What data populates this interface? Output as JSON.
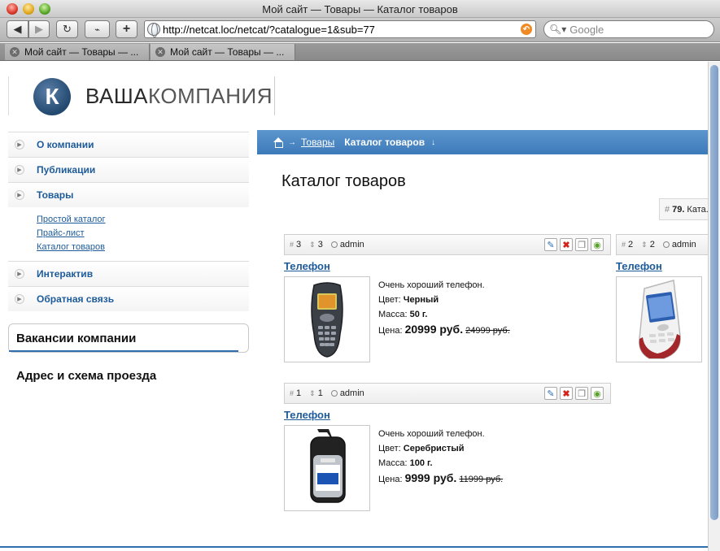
{
  "browser": {
    "window_title": "Мой сайт — Товары — Каталог товаров",
    "url": "http://netcat.loc/netcat/?catalogue=1&sub=77",
    "search_placeholder": "Google",
    "tabs": [
      {
        "label": "Мой сайт — Товары — ..."
      },
      {
        "label": "Мой сайт — Товары — ..."
      }
    ]
  },
  "site": {
    "logo_letter": "К",
    "logo_bold": "ВАША",
    "logo_light": "КОМПАНИЯ"
  },
  "menu": {
    "items": [
      {
        "label": "О компании"
      },
      {
        "label": "Публикации"
      },
      {
        "label": "Товары"
      },
      {
        "label": "Интерактив"
      },
      {
        "label": "Обратная связь"
      }
    ],
    "submenu": [
      {
        "label": "Простой каталог"
      },
      {
        "label": "Прайс-лист"
      },
      {
        "label": "Каталог товаров"
      }
    ],
    "vacancy_title": "Вакансии компании",
    "address_title": "Адрес и схема проезда"
  },
  "breadcrumb": {
    "link": "Товары",
    "current": "Каталог товаров"
  },
  "page": {
    "heading": "Каталог товаров",
    "sort_num": "79.",
    "sort_text": "Ката..."
  },
  "products": [
    {
      "id": "3",
      "priority": "3",
      "user": "admin",
      "title": "Телефон",
      "description": "Очень хороший телефон.",
      "color_label": "Цвет:",
      "color": "Черный",
      "mass_label": "Масса:",
      "mass": "50 г.",
      "price_label": "Цена:",
      "price": "20999 руб.",
      "old_price": "24999 руб."
    },
    {
      "id": "2",
      "priority": "2",
      "user": "admin",
      "title": "Телефон"
    },
    {
      "id": "1",
      "priority": "1",
      "user": "admin",
      "title": "Телефон",
      "description": "Очень хороший телефон.",
      "color_label": "Цвет:",
      "color": "Серебристый",
      "mass_label": "Масса:",
      "mass": "100 г.",
      "price_label": "Цена:",
      "price": "9999 руб.",
      "old_price": "11999 руб."
    }
  ],
  "colors": {
    "link": "#1d5b9a",
    "crumb_bar": "#4a88c4"
  }
}
